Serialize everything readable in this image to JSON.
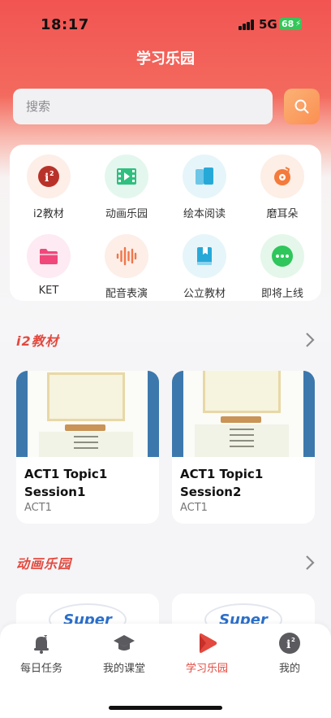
{
  "status_bar": {
    "time": "18:17",
    "network": "5G",
    "battery": "68"
  },
  "header": {
    "title": "学习乐园"
  },
  "search": {
    "placeholder": "搜索"
  },
  "menu": {
    "items": [
      {
        "label": "i2教材",
        "icon": "i2-textbook-icon",
        "bg": "#fdeee8",
        "color": "#b8322a"
      },
      {
        "label": "动画乐园",
        "icon": "film-icon",
        "bg": "#e4f7ee",
        "color": "#2fbf7f"
      },
      {
        "label": "绘本阅读",
        "icon": "book-icon",
        "bg": "#e6f5fa",
        "color": "#27a9d8"
      },
      {
        "label": "磨耳朵",
        "icon": "music-disc-icon",
        "bg": "#fdeee6",
        "color": "#f47b3b"
      },
      {
        "label": "KET",
        "icon": "folder-icon",
        "bg": "#fdeaf2",
        "color": "#f0487b"
      },
      {
        "label": "配音表演",
        "icon": "sound-wave-icon",
        "bg": "#fdeee8",
        "color": "#f0764a"
      },
      {
        "label": "公立教材",
        "icon": "bookmark-book-icon",
        "bg": "#e6f5fa",
        "color": "#27a9d8"
      },
      {
        "label": "即将上线",
        "icon": "more-dots-icon",
        "bg": "#e4f7ea",
        "color": "#2fc65c"
      }
    ]
  },
  "sections": {
    "i2": {
      "title": "i2教材",
      "cards": [
        {
          "title": "ACT1 Topic1 Session1",
          "subtitle": "ACT1"
        },
        {
          "title": "ACT1 Topic1 Session2",
          "subtitle": "ACT1"
        }
      ]
    },
    "animation": {
      "title": "动画乐园",
      "cards": [
        {
          "logo_text": "Super"
        },
        {
          "logo_text": "Super"
        }
      ]
    }
  },
  "tabbar": {
    "tabs": [
      {
        "label": "每日任务",
        "icon": "alarm-bell-icon",
        "active": false
      },
      {
        "label": "我的课堂",
        "icon": "graduation-cap-icon",
        "active": false
      },
      {
        "label": "学习乐园",
        "icon": "play-icon",
        "active": true
      },
      {
        "label": "我的",
        "icon": "info-icon",
        "active": false
      }
    ]
  },
  "colors": {
    "brand": "#f25452",
    "accent": "#e3493f",
    "search_button": "#fb8f52"
  }
}
